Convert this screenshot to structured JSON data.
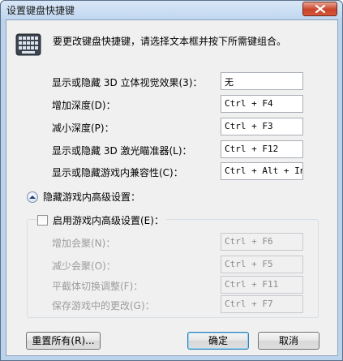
{
  "window": {
    "title": "设置键盘快捷键"
  },
  "intro": "要更改键盘快捷键，请选择文本框并按下所需键组合。",
  "shortcuts": [
    {
      "label": "显示或隐藏 3D 立体视觉效果(3)：",
      "value": "无"
    },
    {
      "label": "增加深度(D)：",
      "value": "Ctrl + F4"
    },
    {
      "label": "减小深度(P)：",
      "value": "Ctrl + F3"
    },
    {
      "label": "显示或隐藏 3D 激光瞄准器(L)：",
      "value": "Ctrl + F12"
    },
    {
      "label": "显示或隐藏游戏内兼容性(C)：",
      "value": "Ctrl + Alt + Ins"
    }
  ],
  "advanced": {
    "section_label": "隐藏游戏内高级设置：",
    "enable_label": "启用游戏内高级设置(E)：",
    "items": [
      {
        "label": "增加会聚(N)：",
        "value": "Ctrl + F6"
      },
      {
        "label": "减少会聚(O)：",
        "value": "Ctrl + F5"
      },
      {
        "label": "平截体切换调整(F)：",
        "value": "Ctrl + F11"
      },
      {
        "label": "保存游戏中的更改(G)：",
        "value": "Ctrl + F7"
      }
    ]
  },
  "buttons": {
    "reset": "重置所有(R)...",
    "ok": "确定",
    "cancel": "取消"
  },
  "icons": {
    "keyboard": "keyboard-icon",
    "close": "close-icon",
    "collapse": "chevron-up-icon"
  }
}
